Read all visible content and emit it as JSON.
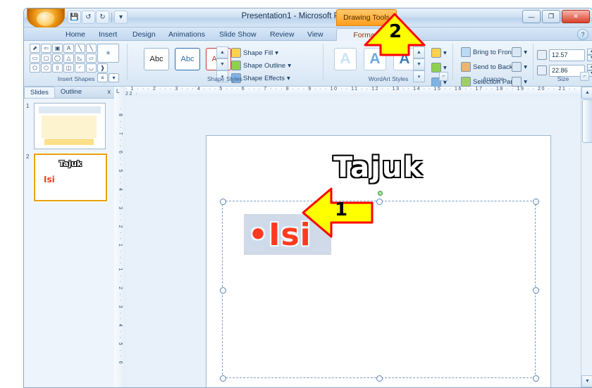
{
  "window": {
    "title": "Presentation1 - Microsoft PowerPoint",
    "contextual_tab_group": "Drawing Tools",
    "quick_access": [
      "save-icon",
      "undo-icon",
      "redo-icon",
      "customize-icon"
    ],
    "buttons": {
      "minimize": "—",
      "maximize": "❐",
      "close": "✕"
    },
    "help": "?"
  },
  "ribbon": {
    "tabs": [
      {
        "label": "Home",
        "active": false
      },
      {
        "label": "Insert",
        "active": false
      },
      {
        "label": "Design",
        "active": false
      },
      {
        "label": "Animations",
        "active": false
      },
      {
        "label": "Slide Show",
        "active": false
      },
      {
        "label": "Review",
        "active": false
      },
      {
        "label": "View",
        "active": false
      },
      {
        "label": "Format",
        "active": true
      }
    ],
    "groups": [
      {
        "name": "Insert Shapes"
      },
      {
        "name": "Shape Styles"
      },
      {
        "name": "WordArt Styles"
      },
      {
        "name": "Arrange"
      },
      {
        "name": "Size"
      }
    ],
    "shape_styles": {
      "previews": [
        "Abc",
        "Abc",
        "Abc"
      ],
      "commands": [
        {
          "label": "Shape Fill",
          "icon": "paint-bucket-icon"
        },
        {
          "label": "Shape Outline",
          "icon": "pen-outline-icon"
        },
        {
          "label": "Shape Effects",
          "icon": "effects-icon"
        }
      ]
    },
    "wordart_styles": {
      "previews": [
        "A",
        "A",
        "A"
      ],
      "commands": [
        {
          "label": "",
          "icon": "text-fill-icon"
        },
        {
          "label": "",
          "icon": "text-outline-icon"
        },
        {
          "label": "",
          "icon": "text-effects-icon"
        }
      ]
    },
    "arrange": {
      "commands": [
        {
          "label": "Bring to Front",
          "icon": "bring-to-front-icon"
        },
        {
          "label": "Send to Back",
          "icon": "send-to-back-icon"
        },
        {
          "label": "Selection Pane",
          "icon": "selection-pane-icon"
        }
      ],
      "side_commands": [
        {
          "icon": "align-icon"
        },
        {
          "icon": "group-icon"
        },
        {
          "icon": "rotate-icon"
        }
      ]
    },
    "size": {
      "height": {
        "label": "height-field",
        "value": "12.57",
        "icon": "height-icon"
      },
      "width": {
        "label": "width-field",
        "value": "22.86",
        "icon": "width-icon"
      }
    }
  },
  "slide_pane": {
    "tabs": [
      {
        "label": "Slides",
        "selected": true
      },
      {
        "label": "Outline",
        "selected": false
      }
    ],
    "close": "x",
    "thumbnails": [
      {
        "number": "1",
        "selected": false
      },
      {
        "number": "2",
        "selected": true,
        "title": "Tajuk",
        "body": "Isi"
      }
    ]
  },
  "ruler": {
    "horizontal": "· 1 · · · 2 · · · 3 · · · 4 · · · 5 · · · 6 · · · 7 · · · 8 · · · 9 · · · 10 · · 11 · · 12 · · 13 · · 14 · · 15 · · 16 · · 17 · · 18 · · 19 · · 20 · · 21 · · 22 ·",
    "vertical_marker": "L"
  },
  "slide": {
    "title_text": "Tajuk",
    "body_text": "Isi",
    "body_bullet": "•",
    "placeholder_selected": true
  },
  "callouts": [
    {
      "number": "1",
      "direction": "left",
      "target": "body-text-isi"
    },
    {
      "number": "2",
      "direction": "up",
      "target": "format-tab"
    }
  ],
  "colors": {
    "callout_fill": "#ffff00",
    "callout_stroke": "#ff0000",
    "accent_orange": "#ff9d1c",
    "isi_red": "#ff3b1f"
  },
  "scrollbar": {
    "up": "▲",
    "down": "▼"
  }
}
